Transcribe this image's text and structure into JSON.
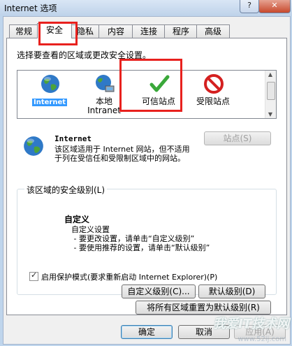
{
  "window": {
    "title": "Internet 选项",
    "help_label": "?",
    "close_label": "✕"
  },
  "tabs": [
    {
      "label": "常规"
    },
    {
      "label": "安全",
      "active": true
    },
    {
      "label": "隐私"
    },
    {
      "label": "内容"
    },
    {
      "label": "连接"
    },
    {
      "label": "程序"
    },
    {
      "label": "高级"
    }
  ],
  "security": {
    "select_zone_label": "选择要查看的区域或更改安全设置。",
    "zones": [
      {
        "label": "Internet",
        "selected": true,
        "icon": "globe-icon"
      },
      {
        "label": "本地\nIntranet",
        "icon": "network-globe-icon"
      },
      {
        "label": "可信站点",
        "icon": "checkmark-icon"
      },
      {
        "label": "受限站点",
        "icon": "no-entry-icon"
      }
    ],
    "sites_button": "站点(S)",
    "zone_title": "Internet",
    "zone_description": "该区域适用于 Internet 网站，但不适用于列在受信任和受限制区域中的网站。",
    "level_group_title": "该区域的安全级别(L)",
    "level_title": "自定义",
    "level_description": "自定义设置\n - 要更改设置，请单击“自定义级别”\n - 要使用推荐的设置，请单击“默认级别”",
    "protected_mode_label": "启用保护模式(要求重新启动 Internet Explorer)(P)",
    "protected_mode_checked": true,
    "custom_level_button": "自定义级别(C)...",
    "default_level_button": "默认级别(D)",
    "reset_all_button": "将所有区域重置为默认级别(R)"
  },
  "footer": {
    "ok_button": "确定",
    "cancel_button": "取消",
    "apply_button": "应用(A)"
  },
  "watermark": {
    "main": "我爱IT技术网",
    "sub": "www.52ij.com"
  },
  "colors": {
    "highlight_red": "#e8211e",
    "selection_blue": "#3399ff"
  }
}
